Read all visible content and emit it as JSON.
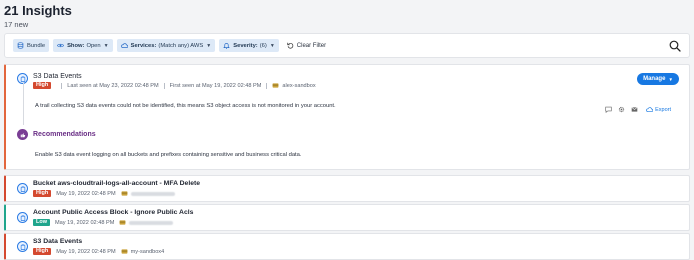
{
  "header": {
    "title": "21 Insights",
    "subtitle": "17 new"
  },
  "filters": {
    "bundle_label": "Bundle",
    "show_key": "Show:",
    "show_value": "Open",
    "services_key": "Services:",
    "services_value": "(Match any) AWS",
    "severity_key": "Severity:",
    "severity_value": "(6)",
    "clear_label": "Clear Filter"
  },
  "open_insight": {
    "title": "S3 Data Events",
    "severity": "High",
    "last_seen": "Last seen at May 23, 2022 02:48 PM",
    "first_seen": "First seen at May 19, 2022 02:48 PM",
    "account": "alex-sandbox",
    "manage_label": "Manage",
    "description": "A trail collecting S3 data events could not be identified, this means S3 object access is not monitored in your account.",
    "export_label": "Export",
    "recommendations_title": "Recommendations",
    "recommendation_text": "Enable S3 data event logging on all buckets and prefixes containing sensitive and business critical data."
  },
  "insights": [
    {
      "title": "Bucket aws-cloudtrail-logs-all-account - MFA Delete",
      "severity": "High",
      "date": "May 19, 2022 02:48 PM",
      "account": ""
    },
    {
      "title": "Account Public Access Block - Ignore Public Acls",
      "severity": "Low",
      "date": "May 19, 2022 02:48 PM",
      "account": ""
    },
    {
      "title": "S3 Data Events",
      "severity": "High",
      "date": "May 19, 2022 02:48 PM",
      "account": "my-sandbox4"
    }
  ],
  "colors": {
    "accent": "#1778e2",
    "high": "#d4492f",
    "low": "#1fa58c",
    "recommendation": "#6a2f86"
  }
}
